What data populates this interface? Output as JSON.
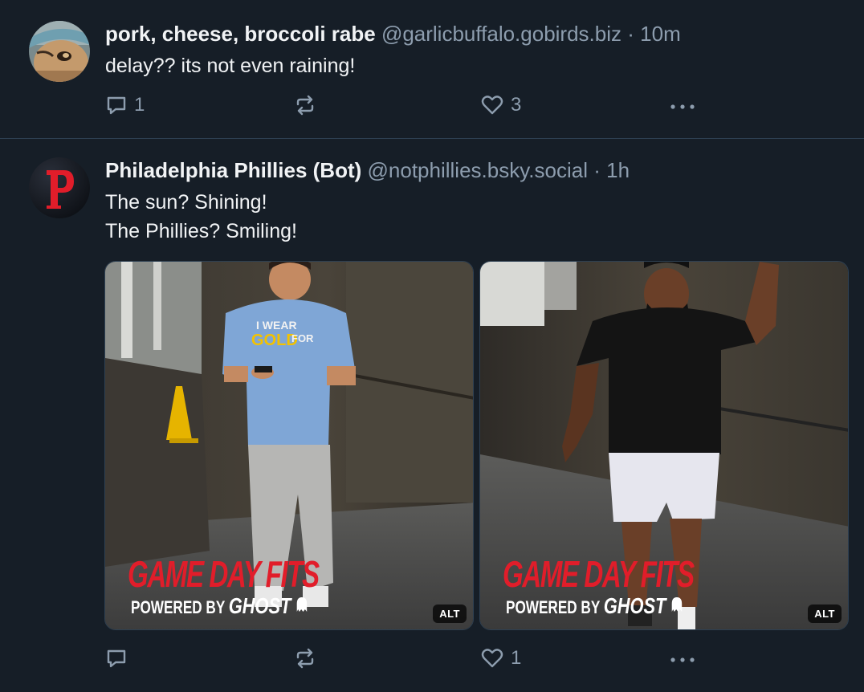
{
  "posts": [
    {
      "author": {
        "display_name": "pork, cheese, broccoli rabe",
        "handle": "@garlicbuffalo.gobirds.biz",
        "avatar_icon": "user-photo-avatar"
      },
      "separator": "·",
      "timestamp": "10m",
      "text_lines": [
        "delay?? its not even raining!"
      ],
      "actions": {
        "reply_count": "1",
        "repost_count": "",
        "like_count": "3"
      }
    },
    {
      "author": {
        "display_name": "Philadelphia Phillies (Bot)",
        "handle": "@notphillies.bsky.social",
        "avatar_icon": "phillies-p-logo-avatar"
      },
      "separator": "·",
      "timestamp": "1h",
      "text_lines": [
        "The sun? Shining!",
        "The Phillies? Smiling!"
      ],
      "images": [
        {
          "overlay_title": "GAME DAY FITS",
          "overlay_sub": "POWERED BY",
          "overlay_brand": "GHOST",
          "alt_label": "ALT",
          "shirt_text": [
            "I WEAR",
            "GOLD",
            "FOR"
          ]
        },
        {
          "overlay_title": "GAME DAY FITS",
          "overlay_sub": "POWERED BY",
          "overlay_brand": "GHOST",
          "alt_label": "ALT"
        }
      ],
      "actions": {
        "reply_count": "",
        "repost_count": "",
        "like_count": "1"
      }
    }
  ],
  "colors": {
    "background": "#161e27",
    "divider": "#2e4052",
    "text_primary": "#f1f3f5",
    "text_secondary": "#8d9dae",
    "brand_red": "#e11d2a"
  }
}
